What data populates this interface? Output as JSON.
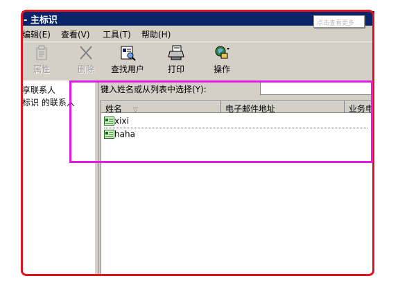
{
  "window": {
    "title": "- 主标识"
  },
  "menu": [
    "编辑(E)",
    "查看(V)",
    "工具(T)",
    "帮助(H)"
  ],
  "tooltip": "点击查看更多",
  "toolbar": {
    "properties": {
      "label": "属性",
      "icon": "properties-icon",
      "enabled": false
    },
    "delete": {
      "label": "删除",
      "icon": "delete-icon",
      "enabled": false
    },
    "find_people": {
      "label": "查找用户",
      "icon": "find-people-icon",
      "enabled": true
    },
    "print": {
      "label": "打印",
      "icon": "printer-icon",
      "enabled": true
    },
    "action": {
      "label": "操作",
      "icon": "action-icon",
      "enabled": true
    }
  },
  "tree": [
    "享联系人",
    "标识 的联系人"
  ],
  "search": {
    "label": "键入姓名或从列表中选择(Y):",
    "value": ""
  },
  "list": {
    "columns": [
      "姓名",
      "电子邮件地址",
      "业务电话"
    ],
    "sort_indicator": "▽",
    "rows": [
      {
        "name": "xixi",
        "icon": "contact-card-icon"
      },
      {
        "name": "haha",
        "icon": "contact-card-icon"
      }
    ]
  },
  "colors": {
    "titlebar": "#0a246a",
    "highlight_red": "#e0141c",
    "highlight_magenta": "#e31ce3",
    "face": "#d4d0c8"
  }
}
